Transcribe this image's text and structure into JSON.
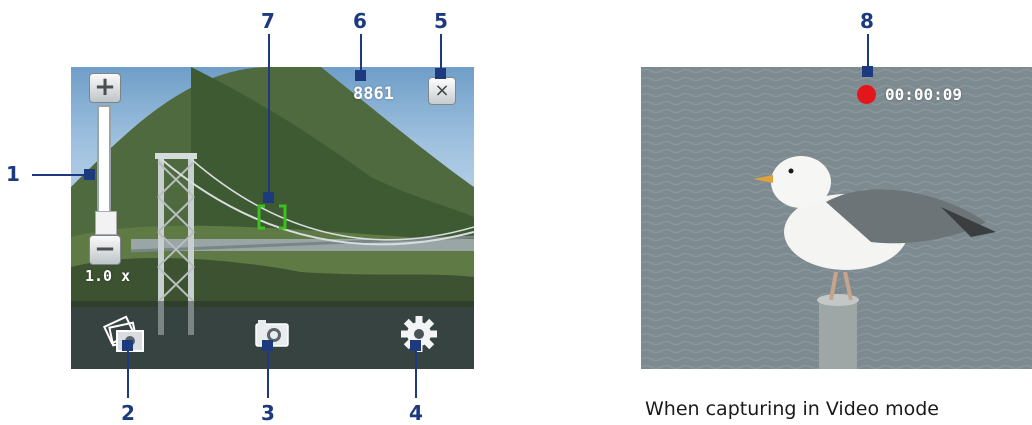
{
  "callouts": [
    {
      "number": "1"
    },
    {
      "number": "2"
    },
    {
      "number": "3"
    },
    {
      "number": "4"
    },
    {
      "number": "5"
    },
    {
      "number": "6"
    },
    {
      "number": "7"
    },
    {
      "number": "8"
    }
  ],
  "photo_mode": {
    "remaining_shots": "8861",
    "zoom_level": "1.0 x",
    "zoom_in_label": "+",
    "zoom_out_label": "−",
    "close_label": "×",
    "icons": {
      "zoom_in": "plus-icon",
      "zoom_out": "minus-icon",
      "close": "close-icon",
      "album": "album-icon",
      "capture": "camera-icon",
      "settings": "gear-icon",
      "focus": "focus-bracket-icon"
    }
  },
  "video_mode": {
    "recording_time": "00:00:09",
    "record_indicator_color": "#e3161b",
    "caption": "When capturing in Video mode"
  },
  "colors": {
    "callout": "#1d3a7e",
    "focus_bracket": "#3cc21d"
  }
}
